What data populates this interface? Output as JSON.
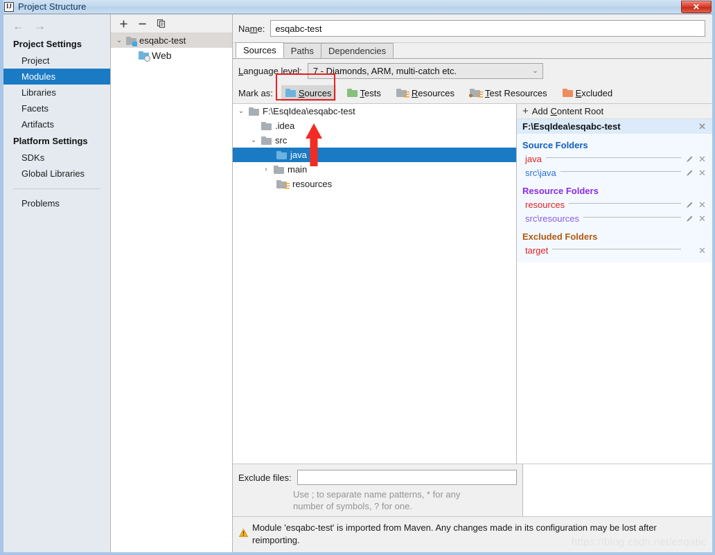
{
  "window": {
    "title": "Project Structure",
    "app_icon": "intellij-idea-icon",
    "close_label": "✕"
  },
  "sidebar": {
    "back_arrow": "←",
    "forward_arrow": "→",
    "groups": [
      {
        "title": "Project Settings",
        "items": [
          {
            "label": "Project",
            "selected": false
          },
          {
            "label": "Modules",
            "selected": true
          },
          {
            "label": "Libraries",
            "selected": false
          },
          {
            "label": "Facets",
            "selected": false
          },
          {
            "label": "Artifacts",
            "selected": false
          }
        ]
      },
      {
        "title": "Platform Settings",
        "items": [
          {
            "label": "SDKs",
            "selected": false
          },
          {
            "label": "Global Libraries",
            "selected": false
          }
        ]
      }
    ],
    "problems_label": "Problems"
  },
  "modules": {
    "toolbar": {
      "add": "+",
      "remove": "−",
      "copy": "copy-icon"
    },
    "tree": [
      {
        "label": "esqabc-test",
        "icon": "module-folder-icon",
        "twisty": "⌄",
        "depth": 0,
        "selected": true
      },
      {
        "label": "Web",
        "icon": "web-facet-icon",
        "twisty": "",
        "depth": 1,
        "selected": false
      }
    ]
  },
  "main": {
    "name_label_pre": "Na",
    "name_label_mnemonic": "m",
    "name_label_post": "e:",
    "name_value": "esqabc-test",
    "tabs": [
      {
        "label": "Sources",
        "active": true
      },
      {
        "label": "Paths",
        "active": false
      },
      {
        "label": "Dependencies",
        "active": false
      }
    ],
    "language_level": {
      "label_mnemonic": "L",
      "label_rest": "anguage level:",
      "value": "7 - Diamonds, ARM, multi-catch etc.",
      "chevron": "⌄"
    },
    "mark_as": {
      "label": "Mark as:",
      "buttons": [
        {
          "pre": "",
          "mnemonic": "S",
          "post": "ources",
          "icon": "sources-folder-icon",
          "active": true
        },
        {
          "pre": "",
          "mnemonic": "T",
          "post": "ests",
          "icon": "tests-folder-icon",
          "active": false
        },
        {
          "pre": "",
          "mnemonic": "R",
          "post": "esources",
          "icon": "resources-folder-icon",
          "active": false
        },
        {
          "pre": "",
          "mnemonic": "T",
          "post": "est Resources",
          "icon": "test-resources-folder-icon",
          "active": false
        },
        {
          "pre": "",
          "mnemonic": "E",
          "post": "xcluded",
          "icon": "excluded-folder-icon",
          "active": false
        }
      ]
    }
  },
  "file_tree": [
    {
      "label": "F:\\EsqIdea\\esqabc-test",
      "twisty": "⌄",
      "indent": 0,
      "icon": "folder-icon",
      "icon_kind": "gray",
      "selected": false
    },
    {
      "label": ".idea",
      "twisty": "",
      "indent": 1,
      "icon": "folder-icon",
      "icon_kind": "gray",
      "selected": false
    },
    {
      "label": "src",
      "twisty": "⌄",
      "indent": 1,
      "icon": "folder-icon",
      "icon_kind": "gray",
      "selected": false
    },
    {
      "label": "java",
      "twisty": "",
      "indent": 2,
      "icon": "sources-folder-icon",
      "icon_kind": "blue",
      "selected": true
    },
    {
      "label": "main",
      "twisty": "›",
      "indent": 1,
      "icon": "folder-icon",
      "icon_kind": "gray",
      "selected": false
    },
    {
      "label": "resources",
      "twisty": "",
      "indent": 2,
      "icon": "resources-folder-icon",
      "icon_kind": "gray-lines",
      "selected": false
    }
  ],
  "content_roots": {
    "add_label_pre": "Add ",
    "add_label_mnemonic": "C",
    "add_label_post": "ontent Root",
    "plus": "+",
    "root_path": "F:\\EsqIdea\\esqabc-test",
    "root_close": "✕",
    "groups": [
      {
        "title": "Source Folders",
        "title_color": "#1060c0",
        "folders": [
          {
            "name": "java",
            "color": "#e02020",
            "has_pencil": true,
            "has_close": true
          },
          {
            "name": "src\\java",
            "color": "#2a6fd0",
            "has_pencil": true,
            "has_close": true
          }
        ]
      },
      {
        "title": "Resource Folders",
        "title_color": "#8a2be2",
        "folders": [
          {
            "name": "resources",
            "color": "#e02020",
            "has_pencil": true,
            "has_close": true
          },
          {
            "name": "src\\resources",
            "color": "#8a5ce0",
            "has_pencil": true,
            "has_close": true
          }
        ]
      },
      {
        "title": "Excluded Folders",
        "title_color": "#b05a10",
        "folders": [
          {
            "name": "target",
            "color": "#e02020",
            "has_pencil": false,
            "has_close": true
          }
        ]
      }
    ],
    "pencil_glyph": "✎",
    "close_glyph": "✕"
  },
  "bottom": {
    "exclude_label": "Exclude files:",
    "exclude_value": "",
    "exclude_placeholder": "",
    "exclude_hint": "Use ; to separate name patterns, * for any number of symbols, ? for one.",
    "warning_icon": "warning-triangle-icon",
    "warning_text": "Module 'esqabc-test' is imported from Maven. Any changes made in its configuration may be lost after reimporting."
  },
  "annotations": {
    "highlight_rect": "red-rectangle-around-sources-button",
    "arrow": "red-arrow-pointing-to-sources-button"
  },
  "watermark": "https://blog.csdn.net/esqabc",
  "colors": {
    "accent_selection": "#1b7ac4",
    "title_bar": "#c3d9ef",
    "close_red": "#c12f1c",
    "annotation_red": "#e81f1f",
    "source_blue": "#1060c0",
    "resource_purple": "#8a2be2",
    "excluded_brown": "#b05a10",
    "error_red": "#e02020"
  }
}
